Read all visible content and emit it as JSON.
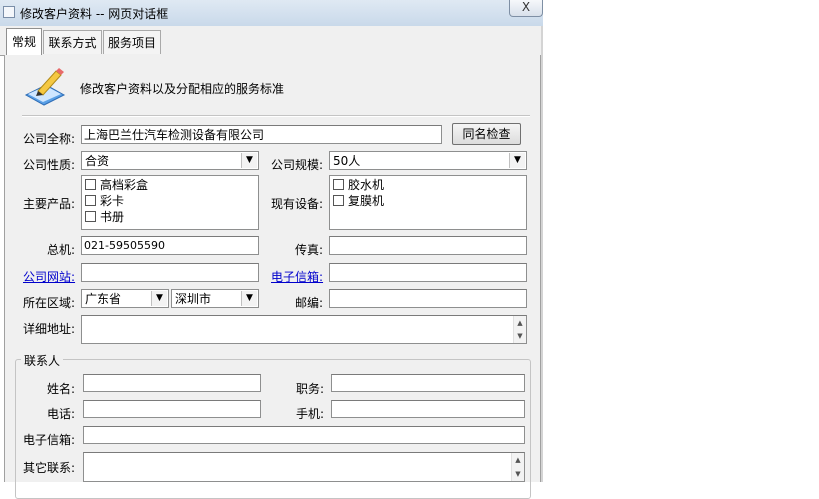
{
  "window": {
    "title": "修改客户资料 -- 网页对话框",
    "close_label": "X"
  },
  "tabs": [
    {
      "label": "常规"
    },
    {
      "label": "联系方式"
    },
    {
      "label": "服务项目"
    }
  ],
  "header": {
    "description": "修改客户资料以及分配相应的服务标准",
    "icon": "edit-pencil-notebook-icon"
  },
  "form": {
    "company_name_label": "公司全称:",
    "company_name_value": "上海巴兰仕汽车检测设备有限公司",
    "check_name_button": "同名检查",
    "company_type_label": "公司性质:",
    "company_type_value": "合资",
    "company_size_label": "公司规模:",
    "company_size_value": "50人",
    "main_products_label": "主要产品:",
    "main_products": [
      "高档彩盒",
      "彩卡",
      "书册"
    ],
    "equipment_label": "现有设备:",
    "equipment": [
      "胶水机",
      "复膜机"
    ],
    "phone_label": "总机:",
    "phone_value": "021-59505590",
    "fax_label": "传真:",
    "fax_value": "",
    "website_label": "公司网站:",
    "website_value": "",
    "email_label": "电子信箱:",
    "email_value": "",
    "region_label": "所在区域:",
    "province_value": "广东省",
    "city_value": "深圳市",
    "postcode_label": "邮编:",
    "postcode_value": "",
    "address_label": "详细地址:",
    "address_value": ""
  },
  "contact": {
    "group_label": "联系人",
    "name_label": "姓名:",
    "title_label": "职务:",
    "tel_label": "电话:",
    "mobile_label": "手机:",
    "email_label": "电子信箱:",
    "other_label": "其它联系:"
  }
}
